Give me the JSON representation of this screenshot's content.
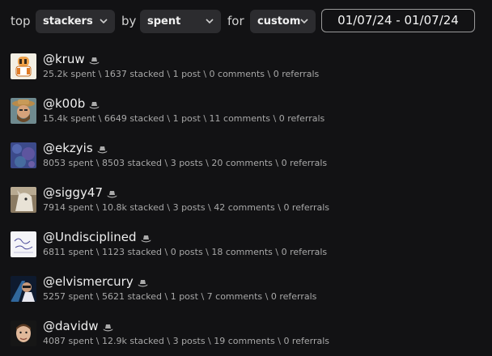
{
  "toolbar": {
    "word_top": "top",
    "select_type": "stackers",
    "word_by": "by",
    "select_by": "spent",
    "word_for": "for",
    "select_when": "custom",
    "date_range": "01/07/24 - 01/07/24"
  },
  "users": [
    {
      "name": "@kruw",
      "stats": "25.2k spent \\ 1637 stacked \\ 1 post \\ 0 comments \\ 0 referrals"
    },
    {
      "name": "@k00b",
      "stats": "15.4k spent \\ 6649 stacked \\ 1 post \\ 11 comments \\ 0 referrals"
    },
    {
      "name": "@ekzyis",
      "stats": "8053 spent \\ 8503 stacked \\ 3 posts \\ 20 comments \\ 0 referrals"
    },
    {
      "name": "@siggy47",
      "stats": "7914 spent \\ 10.8k stacked \\ 3 posts \\ 42 comments \\ 0 referrals"
    },
    {
      "name": "@Undisciplined",
      "stats": "6811 spent \\ 1123 stacked \\ 0 posts \\ 18 comments \\ 0 referrals"
    },
    {
      "name": "@elvismercury",
      "stats": "5257 spent \\ 5621 stacked \\ 1 post \\ 7 comments \\ 0 referrals"
    },
    {
      "name": "@davidw",
      "stats": "4087 spent \\ 12.9k stacked \\ 3 posts \\ 19 comments \\ 0 referrals"
    }
  ],
  "icons": {
    "hat": "cowboy-hat-icon",
    "chevron": "chevron-down-icon"
  },
  "colors": {
    "background": "#121214",
    "select_bg": "#2c2c2f",
    "muted_text": "#a8a8a8"
  }
}
